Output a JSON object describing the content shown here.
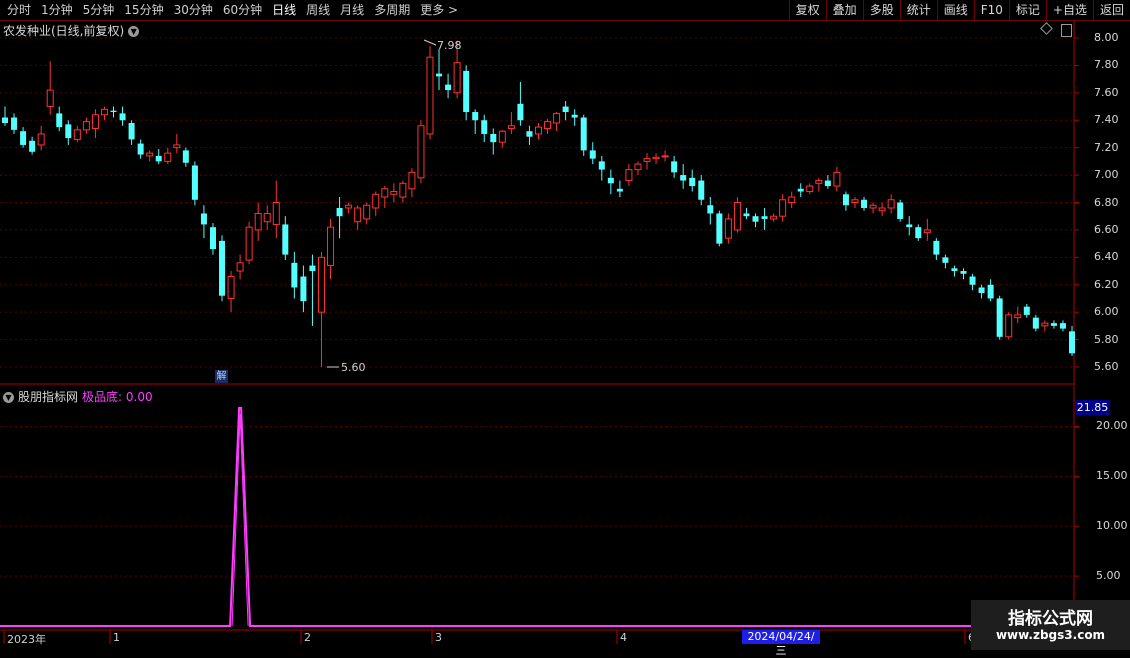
{
  "toolbar": {
    "left_items": [
      "分时",
      "1分钟",
      "5分钟",
      "15分钟",
      "30分钟",
      "60分钟",
      "日线",
      "周线",
      "月线",
      "多周期",
      "更多 >"
    ],
    "active": "日线",
    "right_buttons": [
      "复权",
      "叠加",
      "多股",
      "统计",
      "画线",
      "F10",
      "标记",
      "+自选",
      "返回"
    ]
  },
  "main_panel": {
    "title": "农发种业(日线,前复权)",
    "price_axis": [
      "8.00",
      "7.80",
      "7.60",
      "7.40",
      "7.20",
      "7.00",
      "6.80",
      "6.60",
      "6.40",
      "6.20",
      "6.00",
      "5.80",
      "5.60"
    ],
    "high_label": "7.98",
    "low_label": "5.60",
    "jie_label": "解"
  },
  "sub_panel": {
    "name": "股朋指标网",
    "indicator": "极品底: 0.00",
    "axis_box": "21.85",
    "axis": [
      "20.00",
      "15.00",
      "10.00",
      "5.00"
    ]
  },
  "date_axis": {
    "labels": [
      {
        "text": "2023年",
        "x": 4
      },
      {
        "text": "1",
        "x": 110
      },
      {
        "text": "2",
        "x": 301
      },
      {
        "text": "3",
        "x": 432
      },
      {
        "text": "4",
        "x": 617
      },
      {
        "text": "6",
        "x": 965
      }
    ],
    "highlight": "2024/04/24/三"
  },
  "watermark": {
    "title": "指标公式网",
    "url": "www.zbgs3.com"
  },
  "colors": {
    "up": "#ff3232",
    "down": "#54ffff",
    "indicator": "#ff3cff",
    "border": "#b00000"
  },
  "chart_data": {
    "type": "candlestick",
    "ylim": [
      5.52,
      8.05
    ],
    "candles": [
      [
        7.42,
        7.5,
        7.36,
        7.38
      ],
      [
        7.42,
        7.45,
        7.3,
        7.33
      ],
      [
        7.32,
        7.35,
        7.2,
        7.22
      ],
      [
        7.25,
        7.28,
        7.15,
        7.17
      ],
      [
        7.22,
        7.36,
        7.18,
        7.3
      ],
      [
        7.5,
        7.83,
        7.44,
        7.62
      ],
      [
        7.45,
        7.5,
        7.32,
        7.35
      ],
      [
        7.37,
        7.4,
        7.22,
        7.27
      ],
      [
        7.26,
        7.36,
        7.24,
        7.33
      ],
      [
        7.33,
        7.42,
        7.3,
        7.39
      ],
      [
        7.34,
        7.48,
        7.27,
        7.44
      ],
      [
        7.44,
        7.5,
        7.4,
        7.48
      ],
      [
        7.47,
        7.5,
        7.42,
        7.46
      ],
      [
        7.45,
        7.5,
        7.36,
        7.4
      ],
      [
        7.38,
        7.4,
        7.22,
        7.26
      ],
      [
        7.23,
        7.26,
        7.12,
        7.15
      ],
      [
        7.14,
        7.18,
        7.1,
        7.16
      ],
      [
        7.14,
        7.19,
        7.08,
        7.1
      ],
      [
        7.1,
        7.2,
        7.08,
        7.16
      ],
      [
        7.2,
        7.3,
        7.16,
        7.22
      ],
      [
        7.18,
        7.2,
        7.06,
        7.09
      ],
      [
        7.07,
        7.1,
        6.78,
        6.82
      ],
      [
        6.72,
        6.78,
        6.54,
        6.64
      ],
      [
        6.62,
        6.65,
        6.42,
        6.46
      ],
      [
        6.52,
        6.56,
        6.08,
        6.12
      ],
      [
        6.1,
        6.3,
        6.0,
        6.26
      ],
      [
        6.3,
        6.42,
        6.24,
        6.36
      ],
      [
        6.38,
        6.66,
        6.35,
        6.62
      ],
      [
        6.6,
        6.8,
        6.52,
        6.72
      ],
      [
        6.66,
        6.78,
        6.6,
        6.72
      ],
      [
        6.64,
        6.96,
        6.54,
        6.8
      ],
      [
        6.64,
        6.7,
        6.38,
        6.42
      ],
      [
        6.36,
        6.44,
        6.1,
        6.18
      ],
      [
        6.26,
        6.34,
        6.0,
        6.08
      ],
      [
        6.34,
        6.42,
        5.9,
        6.3
      ],
      [
        6.0,
        6.44,
        5.6,
        6.4
      ],
      [
        6.34,
        6.68,
        6.24,
        6.62
      ],
      [
        6.76,
        6.84,
        6.54,
        6.7
      ],
      [
        6.76,
        6.8,
        6.72,
        6.78
      ],
      [
        6.66,
        6.78,
        6.6,
        6.76
      ],
      [
        6.68,
        6.8,
        6.64,
        6.78
      ],
      [
        6.76,
        6.88,
        6.7,
        6.86
      ],
      [
        6.84,
        6.92,
        6.76,
        6.9
      ],
      [
        6.86,
        6.94,
        6.8,
        6.88
      ],
      [
        6.84,
        6.96,
        6.8,
        6.94
      ],
      [
        6.9,
        7.05,
        6.84,
        7.02
      ],
      [
        6.98,
        7.4,
        6.94,
        7.36
      ],
      [
        7.3,
        7.94,
        7.26,
        7.86
      ],
      [
        7.74,
        7.92,
        7.62,
        7.72
      ],
      [
        7.66,
        7.74,
        7.56,
        7.62
      ],
      [
        7.6,
        7.98,
        7.56,
        7.82
      ],
      [
        7.76,
        7.8,
        7.4,
        7.46
      ],
      [
        7.46,
        7.48,
        7.3,
        7.4
      ],
      [
        7.4,
        7.44,
        7.24,
        7.3
      ],
      [
        7.3,
        7.34,
        7.15,
        7.24
      ],
      [
        7.24,
        7.33,
        7.2,
        7.32
      ],
      [
        7.34,
        7.46,
        7.3,
        7.36
      ],
      [
        7.52,
        7.68,
        7.36,
        7.4
      ],
      [
        7.32,
        7.36,
        7.22,
        7.28
      ],
      [
        7.3,
        7.38,
        7.26,
        7.35
      ],
      [
        7.34,
        7.41,
        7.3,
        7.39
      ],
      [
        7.38,
        7.46,
        7.32,
        7.45
      ],
      [
        7.5,
        7.54,
        7.4,
        7.46
      ],
      [
        7.44,
        7.48,
        7.36,
        7.42
      ],
      [
        7.42,
        7.44,
        7.14,
        7.18
      ],
      [
        7.18,
        7.24,
        7.08,
        7.12
      ],
      [
        7.1,
        7.14,
        6.96,
        7.04
      ],
      [
        6.98,
        7.04,
        6.86,
        6.94
      ],
      [
        6.9,
        6.96,
        6.84,
        6.88
      ],
      [
        6.96,
        7.08,
        6.92,
        7.04
      ],
      [
        7.04,
        7.1,
        7.0,
        7.08
      ],
      [
        7.1,
        7.16,
        7.04,
        7.12
      ],
      [
        7.12,
        7.16,
        7.08,
        7.13
      ],
      [
        7.14,
        7.18,
        7.1,
        7.14
      ],
      [
        7.1,
        7.14,
        6.98,
        7.02
      ],
      [
        7.0,
        7.08,
        6.9,
        6.96
      ],
      [
        6.98,
        7.04,
        6.88,
        6.92
      ],
      [
        6.96,
        7.0,
        6.78,
        6.82
      ],
      [
        6.78,
        6.84,
        6.64,
        6.72
      ],
      [
        6.72,
        6.74,
        6.48,
        6.5
      ],
      [
        6.54,
        6.72,
        6.5,
        6.68
      ],
      [
        6.6,
        6.84,
        6.58,
        6.8
      ],
      [
        6.72,
        6.76,
        6.68,
        6.7
      ],
      [
        6.7,
        6.72,
        6.62,
        6.66
      ],
      [
        6.7,
        6.76,
        6.6,
        6.68
      ],
      [
        6.68,
        6.72,
        6.66,
        6.7
      ],
      [
        6.7,
        6.86,
        6.66,
        6.82
      ],
      [
        6.8,
        6.88,
        6.76,
        6.84
      ],
      [
        6.9,
        6.94,
        6.84,
        6.88
      ],
      [
        6.88,
        6.94,
        6.86,
        6.92
      ],
      [
        6.94,
        6.98,
        6.88,
        6.96
      ],
      [
        6.96,
        7.0,
        6.9,
        6.92
      ],
      [
        6.92,
        7.06,
        6.88,
        7.02
      ],
      [
        6.86,
        6.88,
        6.74,
        6.78
      ],
      [
        6.8,
        6.84,
        6.76,
        6.82
      ],
      [
        6.82,
        6.84,
        6.74,
        6.76
      ],
      [
        6.76,
        6.8,
        6.72,
        6.78
      ],
      [
        6.74,
        6.8,
        6.7,
        6.76
      ],
      [
        6.76,
        6.86,
        6.72,
        6.82
      ],
      [
        6.8,
        6.82,
        6.66,
        6.68
      ],
      [
        6.64,
        6.7,
        6.56,
        6.62
      ],
      [
        6.62,
        6.64,
        6.52,
        6.54
      ],
      [
        6.58,
        6.68,
        6.52,
        6.6
      ],
      [
        6.52,
        6.54,
        6.38,
        6.42
      ],
      [
        6.4,
        6.42,
        6.32,
        6.36
      ],
      [
        6.32,
        6.34,
        6.26,
        6.3
      ],
      [
        6.3,
        6.32,
        6.24,
        6.28
      ],
      [
        6.26,
        6.28,
        6.16,
        6.2
      ],
      [
        6.18,
        6.2,
        6.1,
        6.14
      ],
      [
        6.2,
        6.24,
        6.08,
        6.1
      ],
      [
        6.1,
        6.12,
        5.8,
        5.82
      ],
      [
        5.82,
        6.0,
        5.8,
        5.98
      ],
      [
        5.96,
        6.04,
        5.92,
        5.98
      ],
      [
        6.04,
        6.06,
        5.96,
        5.98
      ],
      [
        5.96,
        5.98,
        5.86,
        5.88
      ],
      [
        5.9,
        5.94,
        5.86,
        5.92
      ],
      [
        5.92,
        5.94,
        5.88,
        5.9
      ],
      [
        5.92,
        5.94,
        5.86,
        5.88
      ],
      [
        5.86,
        5.9,
        5.68,
        5.7
      ]
    ],
    "indicator_series": {
      "name": "极品底",
      "ylim": [
        0,
        21.85
      ],
      "spike_index": 26,
      "spike_value": 21.85
    },
    "indicator_axis": [
      20,
      15,
      10,
      5
    ]
  }
}
